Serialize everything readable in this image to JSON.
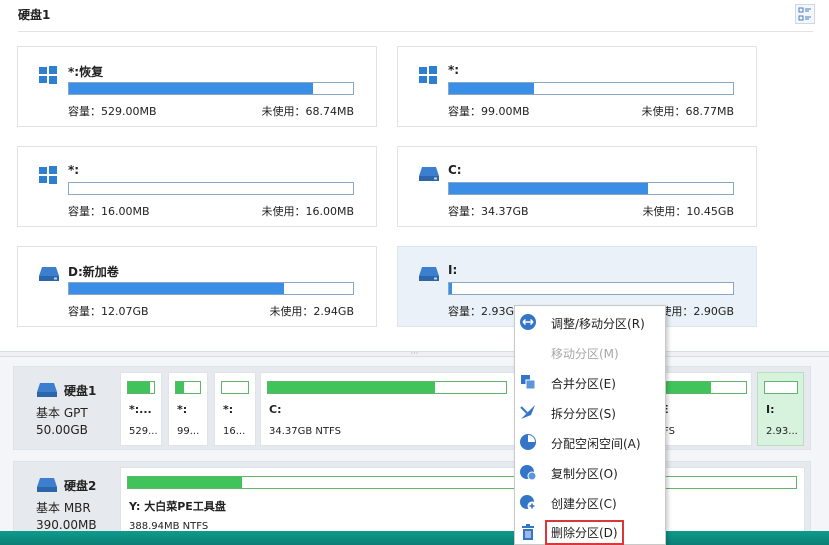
{
  "disk1_title": "硬盘1",
  "partition_cards": [
    {
      "name": "*:恢复",
      "capacity": "容量：529.00MB",
      "unused": "未使用：68.74MB",
      "used_fraction": 0.86,
      "icon": "windows-icon"
    },
    {
      "name": "*:",
      "capacity": "容量：99.00MB",
      "unused": "未使用：68.77MB",
      "used_fraction": 0.3,
      "icon": "windows-icon"
    },
    {
      "name": "*:",
      "capacity": "容量：16.00MB",
      "unused": "未使用：16.00MB",
      "used_fraction": 0.0,
      "icon": "windows-icon"
    },
    {
      "name": "C:",
      "capacity": "容量：34.37GB",
      "unused": "未使用：10.45GB",
      "used_fraction": 0.7,
      "icon": "drive-icon"
    },
    {
      "name": "D:新加卷",
      "capacity": "容量：12.07GB",
      "unused": "未使用：2.94GB",
      "used_fraction": 0.756,
      "icon": "drive-icon"
    },
    {
      "name": "I:",
      "capacity": "容量：2.93GB",
      "unused": "未使用：2.90GB",
      "used_fraction": 0.01,
      "icon": "drive-icon"
    }
  ],
  "disk_map": [
    {
      "name": "硬盘1",
      "type": "基本 GPT",
      "size": "50.00GB",
      "partitions": [
        {
          "label": "*:...",
          "info": "529...",
          "used_fraction": 0.86
        },
        {
          "label": "*:",
          "info": "99...",
          "used_fraction": 0.35
        },
        {
          "label": "*:",
          "info": "16...",
          "used_fraction": 0.0
        },
        {
          "label": "C:",
          "info": "34.37GB NTFS",
          "used_fraction": 0.7
        },
        {
          "label": "E",
          "info": "FS",
          "used_fraction": 0.6
        },
        {
          "label": "I:",
          "info": "2.93...",
          "used_fraction": 0.0
        }
      ]
    },
    {
      "name": "硬盘2",
      "type": "基本 MBR",
      "size": "390.00MB",
      "partitions": [
        {
          "label": "Y: 大白菜PE工具盘",
          "info": "388.94MB NTFS",
          "used_fraction": 0.17
        }
      ]
    }
  ],
  "context_menu": [
    {
      "label": "调整/移动分区(R)",
      "icon": "resize-move-icon",
      "enabled": true
    },
    {
      "label": "移动分区(M)",
      "icon": "",
      "enabled": false
    },
    {
      "label": "合并分区(E)",
      "icon": "merge-icon",
      "enabled": true
    },
    {
      "label": "拆分分区(S)",
      "icon": "split-icon",
      "enabled": true
    },
    {
      "label": "分配空闲空间(A)",
      "icon": "allocate-space-icon",
      "enabled": true
    },
    {
      "label": "复制分区(O)",
      "icon": "copy-partition-icon",
      "enabled": true
    },
    {
      "label": "创建分区(C)",
      "icon": "create-partition-icon",
      "enabled": true
    },
    {
      "label": "删除分区(D)",
      "icon": "trash-icon",
      "enabled": true,
      "highlighted": true
    }
  ],
  "colors": {
    "accent_blue": "#3a8ee6",
    "accent_green": "#3fc35a",
    "highlight_red": "#d9373a"
  }
}
